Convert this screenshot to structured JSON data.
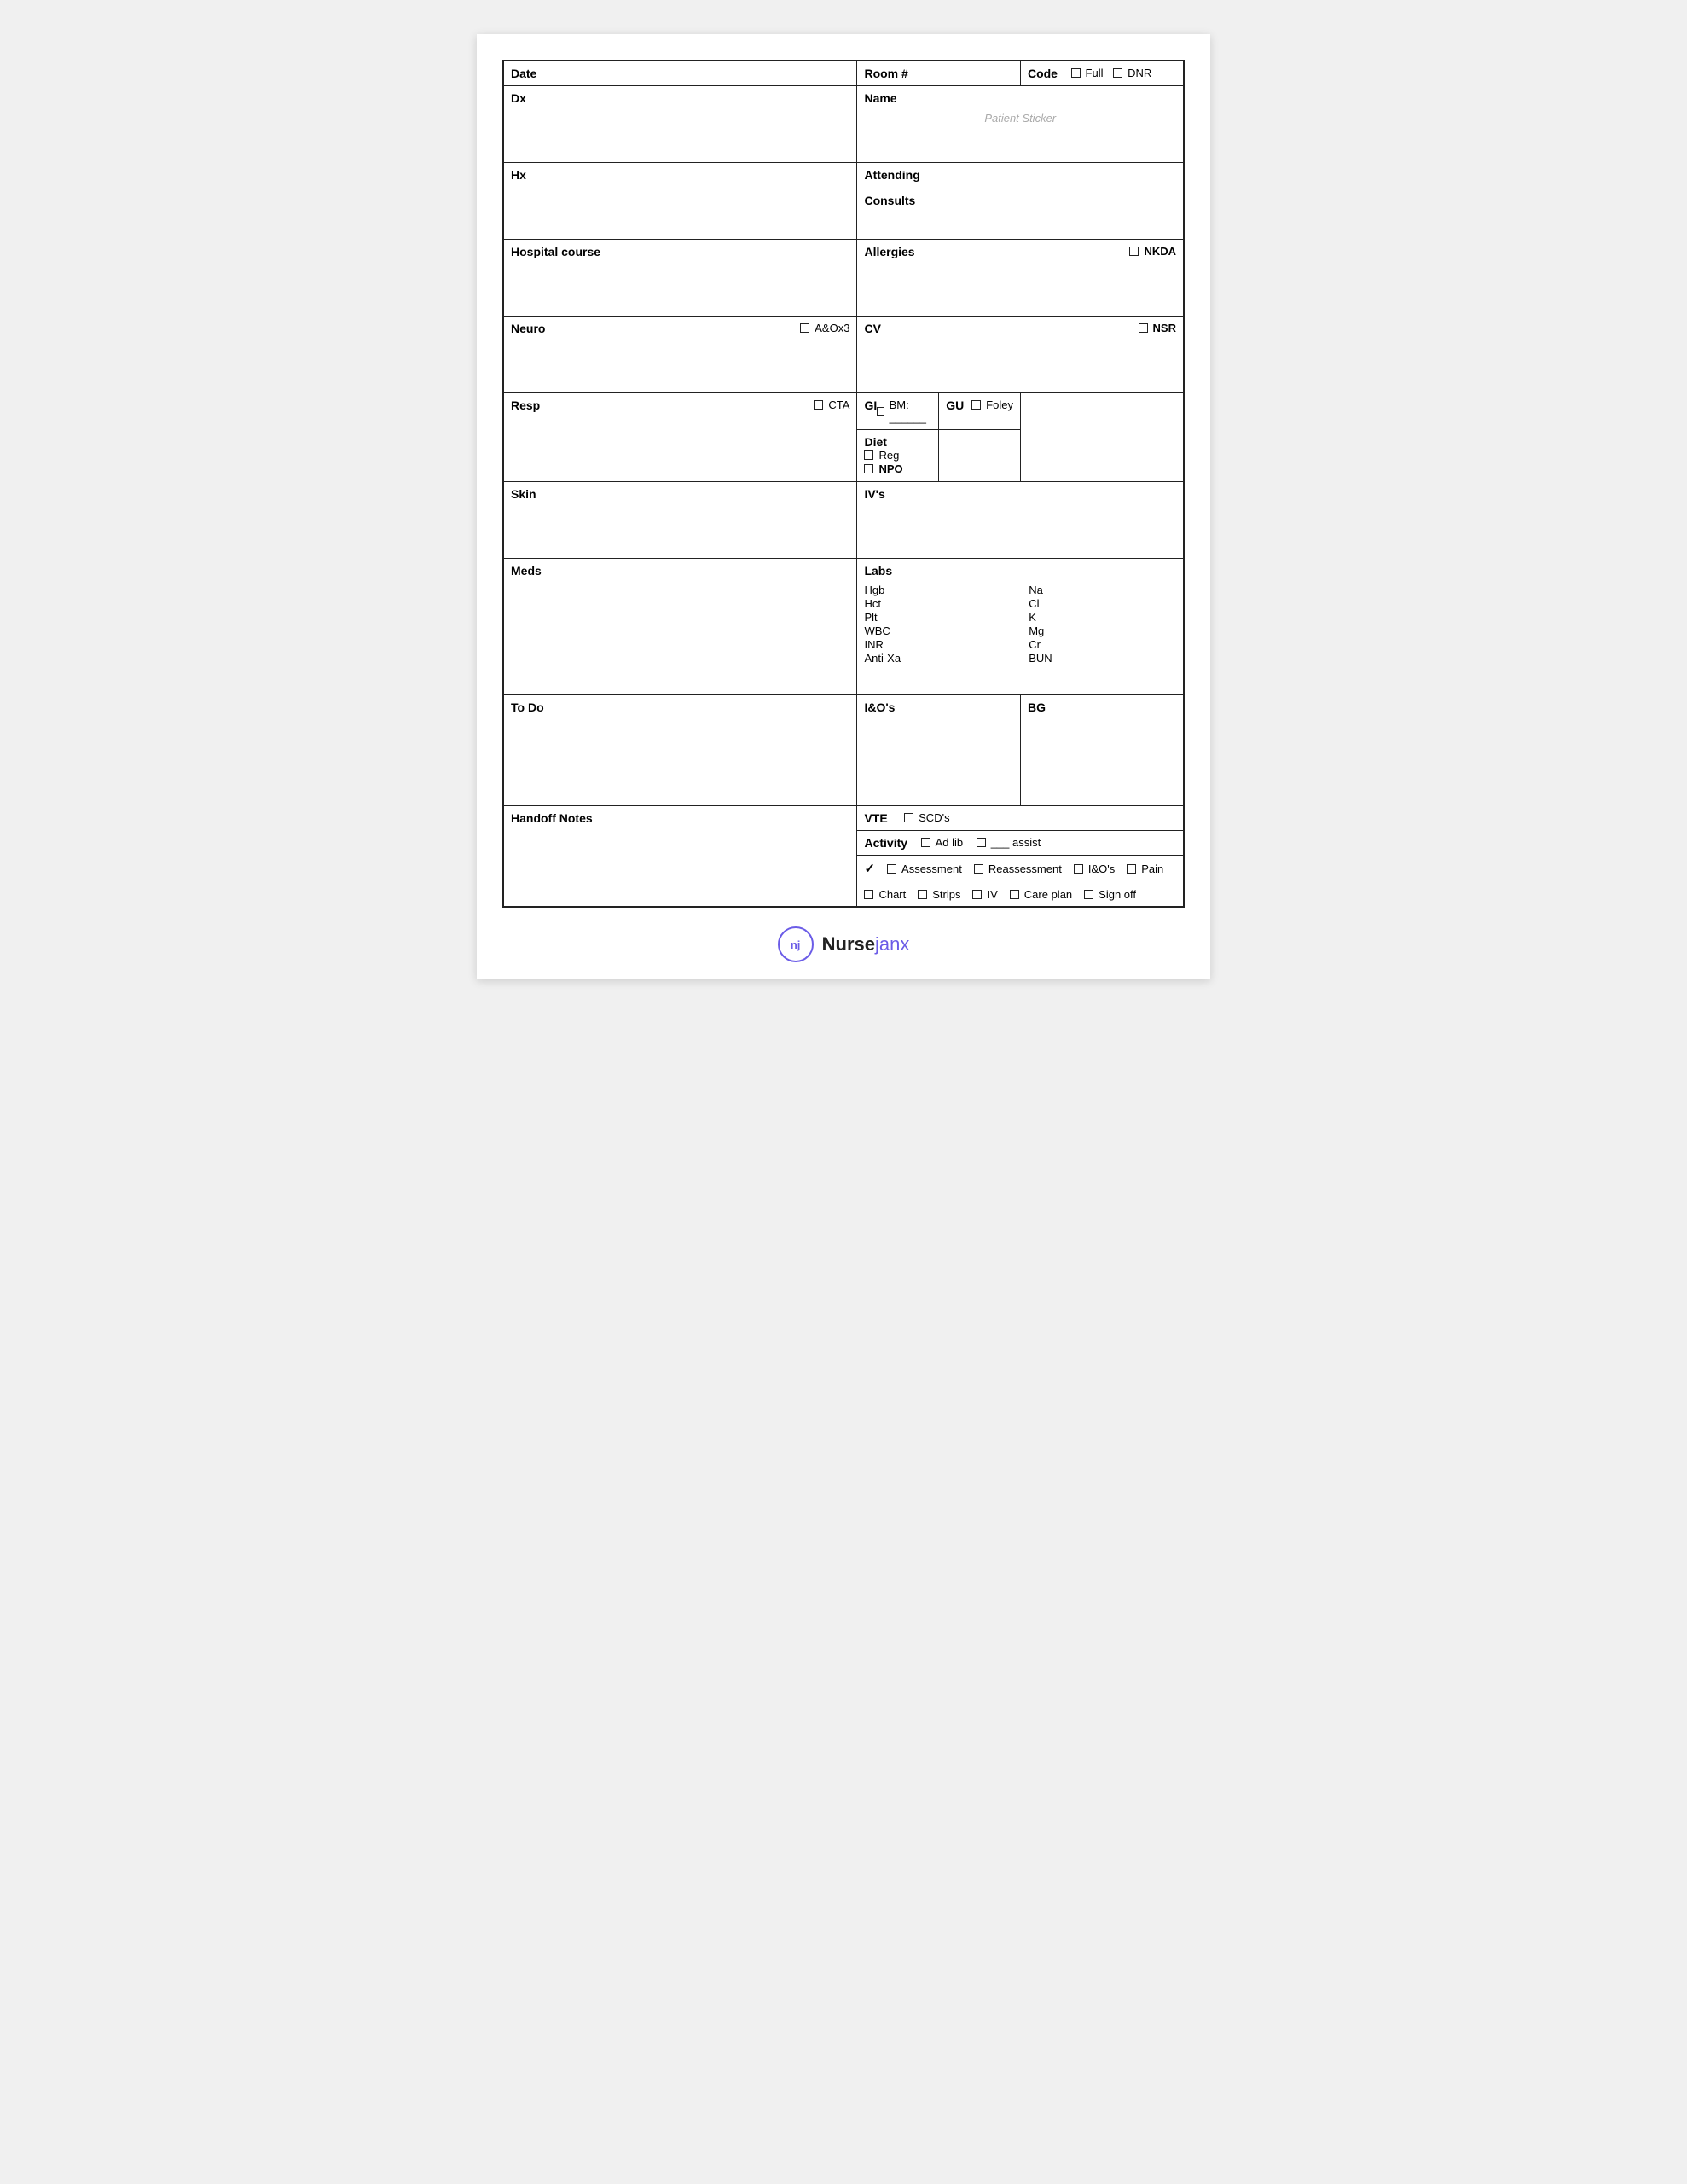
{
  "header": {
    "date_label": "Date",
    "room_label": "Room #",
    "code_label": "Code",
    "full_label": "Full",
    "dnr_label": "DNR"
  },
  "fields": {
    "dx_label": "Dx",
    "name_label": "Name",
    "patient_sticker": "Patient Sticker",
    "hx_label": "Hx",
    "attending_label": "Attending",
    "consults_label": "Consults",
    "hospital_course_label": "Hospital course",
    "allergies_label": "Allergies",
    "nkda_label": "NKDA",
    "neuro_label": "Neuro",
    "aox3_label": "A&Ox3",
    "cv_label": "CV",
    "nsr_label": "NSR",
    "resp_label": "Resp",
    "cta_label": "CTA",
    "gi_label": "GI",
    "bm_label": "BM: ______",
    "gu_label": "GU",
    "foley_label": "Foley",
    "diet_label": "Diet",
    "reg_label": "Reg",
    "npo_label": "NPO",
    "skin_label": "Skin",
    "ivs_label": "IV's",
    "meds_label": "Meds",
    "labs_label": "Labs",
    "labs_left": [
      "Hgb",
      "Hct",
      "Plt",
      "WBC",
      "INR",
      "Anti-Xa"
    ],
    "labs_right": [
      "Na",
      "Cl",
      "K",
      "Mg",
      "Cr",
      "BUN"
    ],
    "todo_label": "To Do",
    "ios_label": "I&O's",
    "bg_label": "BG",
    "handoff_label": "Handoff Notes",
    "vte_label": "VTE",
    "scds_label": "SCD's",
    "activity_label": "Activity",
    "ad_lib_label": "Ad lib",
    "assist_label": "___ assist"
  },
  "footer": {
    "checkmark": "✓",
    "assessment_label": "Assessment",
    "reassessment_label": "Reassessment",
    "ios_label": "I&O's",
    "pain_label": "Pain",
    "chart_label": "Chart",
    "strips_label": "Strips",
    "iv_label": "IV",
    "care_plan_label": "Care plan",
    "sign_off_label": "Sign off"
  },
  "logo": {
    "initials": "nj",
    "nurse": "Nurse",
    "janx": "janx"
  }
}
